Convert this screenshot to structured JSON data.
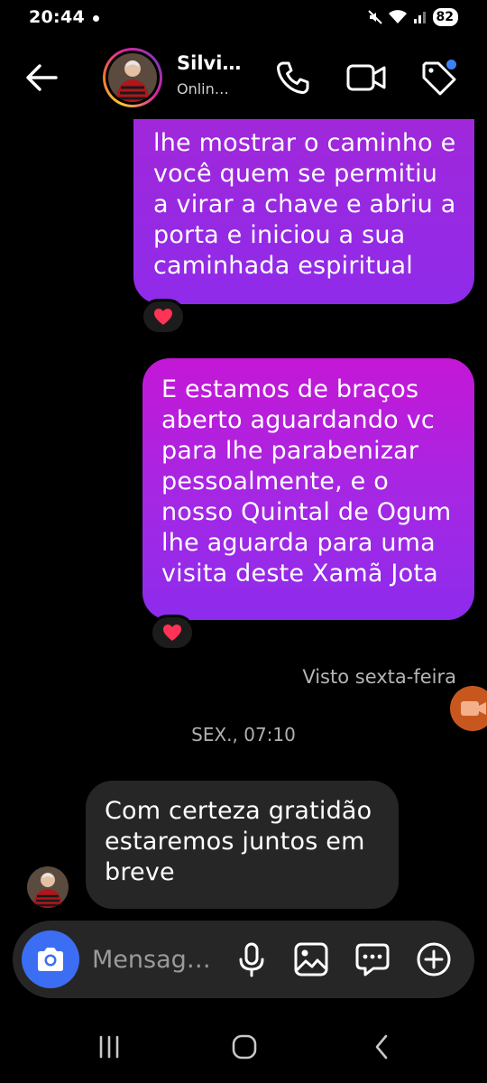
{
  "status_bar": {
    "time": "20:44",
    "battery": "82",
    "icons": [
      "notification-dot",
      "mute-icon",
      "wifi-icon",
      "signal-icon",
      "battery-icon"
    ]
  },
  "header": {
    "contact_name": "Silvi…",
    "contact_status": "Onlin…",
    "icons": [
      "back-arrow-icon",
      "phone-icon",
      "video-camera-icon",
      "tag-icon"
    ]
  },
  "messages": [
    {
      "direction": "outgoing",
      "lines": [
        "lhe mostrar o caminho e",
        "você quem se permitiu",
        "a virar a chave e abriu a",
        "porta e iniciou a sua",
        "caminhada espiritual"
      ],
      "reaction": "❤️"
    },
    {
      "direction": "outgoing",
      "lines": [
        "E estamos de braços",
        "aberto aguardando vc",
        "para lhe parabenizar",
        "pessoalmente, e o",
        "nosso Quintal de Ogum",
        "lhe aguarda para uma",
        "visita deste  Xamã Jota"
      ],
      "reaction": "❤️"
    },
    {
      "direction": "incoming",
      "lines": [
        "Com certeza gratidão",
        "estaremos juntos em",
        "breve"
      ]
    }
  ],
  "seen_text": "Visto sexta-feira",
  "timestamp": "SEX., 07:10",
  "composer": {
    "placeholder": "Mensag…",
    "icons": [
      "camera-icon",
      "microphone-icon",
      "gallery-icon",
      "sticker-icon",
      "plus-icon"
    ]
  },
  "colors": {
    "accent": "#3c6ef4",
    "bubble_purple": "#8f2bea",
    "bubble_magenta": "#c417d6",
    "incoming_bubble": "#262626",
    "heart": "#ff3355"
  }
}
